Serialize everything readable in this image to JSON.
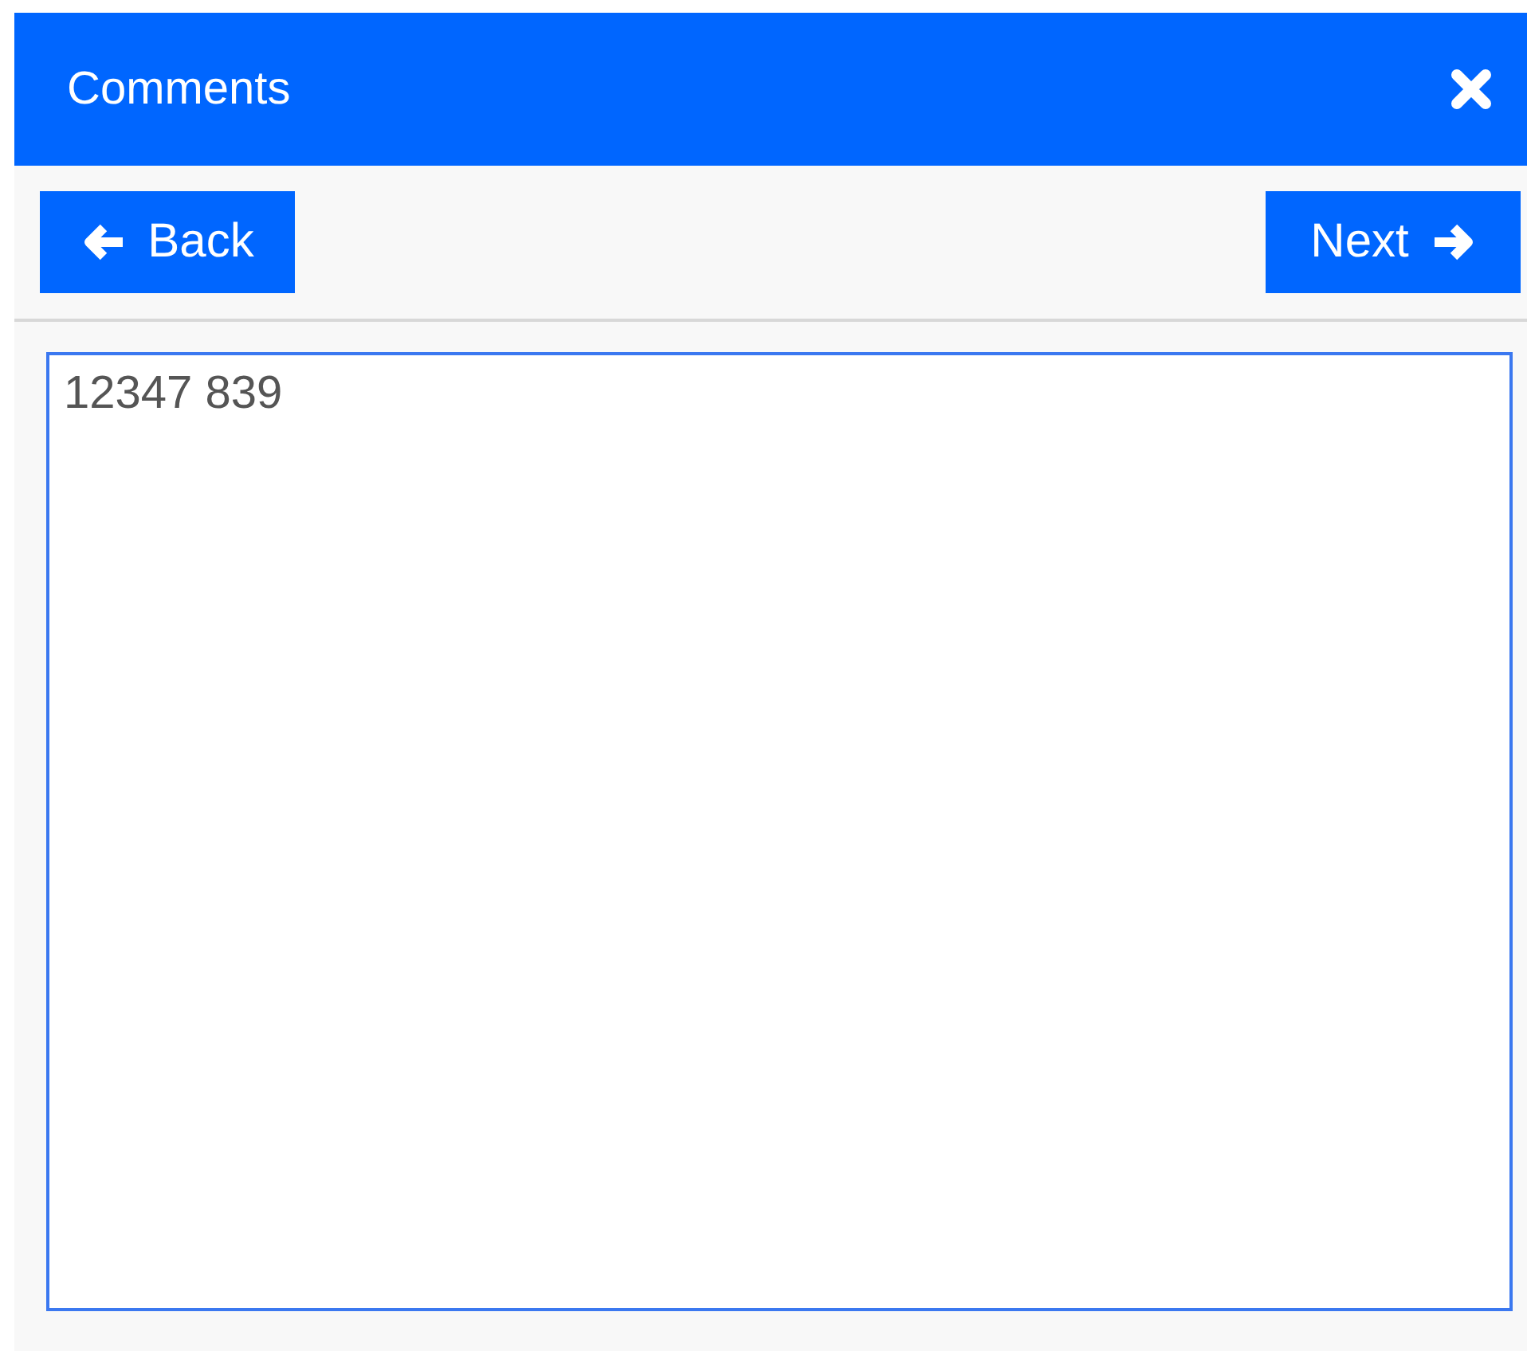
{
  "dialog": {
    "title": "Comments"
  },
  "buttons": [
    {
      "label": "Back",
      "kind": "back"
    },
    {
      "label": "Next",
      "kind": "next"
    }
  ],
  "comment": {
    "value": "12347 839"
  }
}
